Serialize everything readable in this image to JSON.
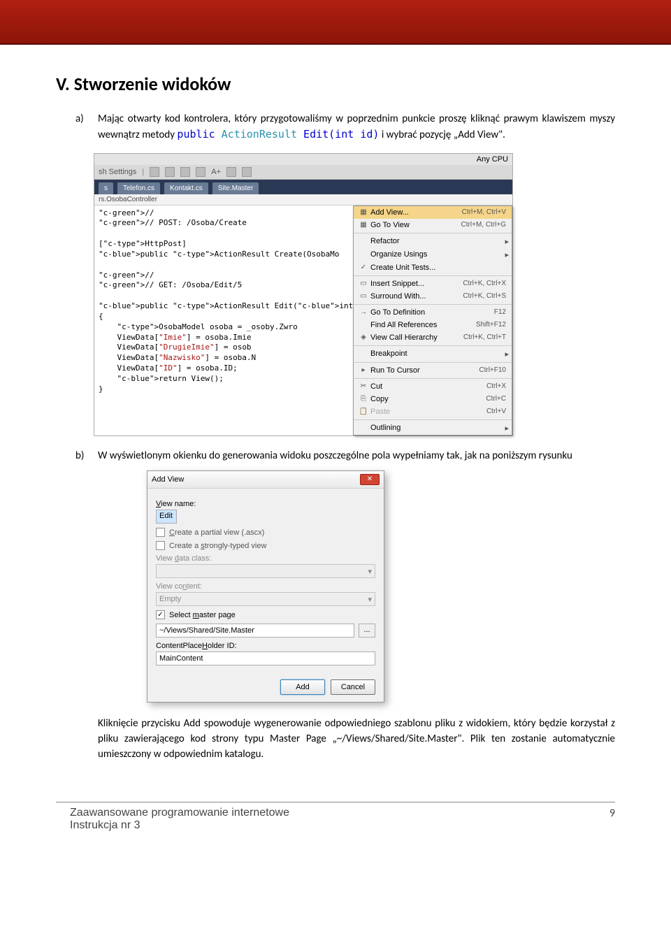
{
  "heading": "V. Stworzenie widoków",
  "item_a": {
    "marker": "a)",
    "text_before": "Mając otwarty kod kontrolera, który przygotowaliśmy w poprzednim punkcie proszę kliknąć prawym klawiszem myszy wewnątrz metody ",
    "code_public": "public",
    "code_type": " ActionResult",
    "code_rest": " Edit(",
    "code_int": "int",
    "code_tail": " id)",
    "text_after": " i wybrać pozycję „Add View\"."
  },
  "vs": {
    "top_right": "Any CPU",
    "settings_label": "sh Settings",
    "toolbar_text": "A+",
    "tabs": [
      "s",
      "Telefon.cs",
      "Kontakt.cs",
      "Site.Master"
    ],
    "crumb": "rs.OsobaController",
    "code": "//\n// POST: /Osoba/Create\n\n[HttpPost]\npublic ActionResult Create(OsobaMo\n\n//\n// GET: /Osoba/Edit/5\n\npublic ActionResult Edit(int id)\n{\n    OsobaModel osoba = _osoby.Zwro\n    ViewData[\"Imie\"] = osoba.Imie\n    ViewData[\"DrugieImie\"] = osob\n    ViewData[\"Nazwisko\"] = osoba.N\n    ViewData[\"ID\"] = osoba.ID;\n    return View();\n}",
    "menu": [
      {
        "label": "Add View...",
        "shortcut": "Ctrl+M, Ctrl+V",
        "hl": true,
        "icon": "▦"
      },
      {
        "label": "Go To View",
        "shortcut": "Ctrl+M, Ctrl+G",
        "icon": "▦"
      },
      {
        "sep": true
      },
      {
        "label": "Refactor",
        "sub": true
      },
      {
        "label": "Organize Usings",
        "sub": true
      },
      {
        "label": "Create Unit Tests...",
        "icon": "✓"
      },
      {
        "sep": true
      },
      {
        "label": "Insert Snippet...",
        "shortcut": "Ctrl+K, Ctrl+X",
        "icon": "▭"
      },
      {
        "label": "Surround With...",
        "shortcut": "Ctrl+K, Ctrl+S",
        "icon": "▭"
      },
      {
        "sep": true
      },
      {
        "label": "Go To Definition",
        "shortcut": "F12",
        "icon": "→"
      },
      {
        "label": "Find All References",
        "shortcut": "Shift+F12"
      },
      {
        "label": "View Call Hierarchy",
        "shortcut": "Ctrl+K, Ctrl+T",
        "icon": "◈"
      },
      {
        "sep": true
      },
      {
        "label": "Breakpoint",
        "sub": true
      },
      {
        "sep": true
      },
      {
        "label": "Run To Cursor",
        "shortcut": "Ctrl+F10",
        "icon": "▸"
      },
      {
        "sep": true
      },
      {
        "label": "Cut",
        "shortcut": "Ctrl+X",
        "icon": "✂"
      },
      {
        "label": "Copy",
        "shortcut": "Ctrl+C",
        "icon": "⎘"
      },
      {
        "label": "Paste",
        "shortcut": "Ctrl+V",
        "icon": "📋",
        "disabled": true
      },
      {
        "sep": true
      },
      {
        "label": "Outlining",
        "sub": true
      }
    ]
  },
  "item_b": {
    "marker": "b)",
    "text": "W wyświetlonym okienku do generowania widoku poszczególne pola wypełniamy tak, jak na poniższym rysunku"
  },
  "dlg": {
    "title": "Add View",
    "view_name_label": "View name:",
    "view_name_value": "Edit",
    "partial_label": "Create a partial view (.ascx)",
    "strongly_label": "Create a strongly-typed view",
    "data_class_label": "View data class:",
    "data_class_value": "",
    "content_label": "View content:",
    "content_value": "Empty",
    "master_label": "Select master page",
    "master_checked": true,
    "master_path": "~/Views/Shared/Site.Master",
    "cph_label": "ContentPlaceHolder ID:",
    "cph_value": "MainContent",
    "add": "Add",
    "cancel": "Cancel"
  },
  "para_after": "Kliknięcie przycisku Add spowoduje wygenerowanie odpowiedniego szablonu pliku z widokiem, który będzie korzystał z pliku zawierającego kod strony typu Master Page „~/Views/Shared/Site.Master\". Plik ten zostanie automatycznie umieszczony w odpowiednim katalogu.",
  "footer": {
    "line1": "Zaawansowane programowanie internetowe",
    "line2": "Instrukcja nr 3",
    "page": "9"
  }
}
